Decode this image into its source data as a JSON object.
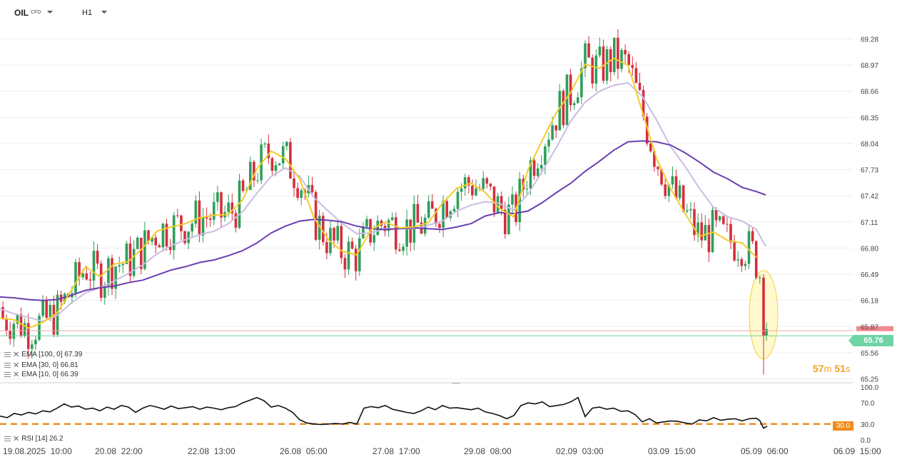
{
  "header": {
    "symbol": "OIL",
    "symbol_type": "CFD",
    "timeframe": "H1"
  },
  "legend": {
    "ema100": "EMA [100, 0] 67.39",
    "ema30": "EMA [30, 0] 66.81",
    "ema10": "EMA [10, 0] 66.39",
    "rsi": "RSI [14] 26.2"
  },
  "countdown": {
    "minutes": "57",
    "min_unit": "m",
    "seconds": "51",
    "sec_unit": "s"
  },
  "last_price": "65.76",
  "rsi_level_label": "30.0",
  "colors": {
    "up": "#2e9e5a",
    "down": "#d42f3c",
    "ema10": "#f2cc2a",
    "ema30": "#c9bde0",
    "ema100": "#6a3fb0",
    "rsi_line": "#111111",
    "rsi_level": "#f08c1c",
    "price_tag": "#6fd4a5",
    "highlight_fill": "#fff7b8",
    "highlight_stroke": "#f2d23a"
  },
  "chart_data": [
    {
      "type": "candlestick",
      "y_ticks": [
        "69.28",
        "68.97",
        "68.66",
        "68.35",
        "68.04",
        "67.73",
        "67.42",
        "67.11",
        "66.80",
        "66.49",
        "66.18",
        "65.87",
        "65.56",
        "65.25"
      ],
      "ylim": [
        65.18,
        69.55
      ],
      "x_tick_labels": [
        "19.08.2025  10:00",
        "20.08  22:00",
        "22.08  13:00",
        "26.08  05:00",
        "27.08  17:00",
        "29.08  08:00",
        "02.09  03:00",
        "03.09  15:00",
        "05.09  06:00",
        "06.09  15:00"
      ],
      "ema100": [
        [
          0,
          66.22
        ],
        [
          20,
          66.21
        ],
        [
          40,
          66.19
        ],
        [
          60,
          66.18
        ],
        [
          80,
          66.19
        ],
        [
          100,
          66.24
        ],
        [
          120,
          66.3
        ],
        [
          140,
          66.33
        ],
        [
          160,
          66.35
        ],
        [
          180,
          66.39
        ],
        [
          200,
          66.42
        ],
        [
          220,
          66.48
        ],
        [
          240,
          66.54
        ],
        [
          260,
          66.58
        ],
        [
          280,
          66.63
        ],
        [
          300,
          66.66
        ],
        [
          320,
          66.71
        ],
        [
          340,
          66.77
        ],
        [
          360,
          66.86
        ],
        [
          380,
          66.98
        ],
        [
          400,
          67.06
        ],
        [
          420,
          67.12
        ],
        [
          440,
          67.14
        ],
        [
          460,
          67.13
        ],
        [
          480,
          67.11
        ],
        [
          500,
          67.06
        ],
        [
          520,
          67.03
        ],
        [
          540,
          67.02
        ],
        [
          560,
          67.03
        ],
        [
          580,
          67.04
        ],
        [
          600,
          67.03
        ],
        [
          620,
          67.02
        ],
        [
          640,
          67.05
        ],
        [
          660,
          67.09
        ],
        [
          680,
          67.18
        ],
        [
          700,
          67.22
        ],
        [
          720,
          67.21
        ],
        [
          740,
          67.24
        ],
        [
          760,
          67.34
        ],
        [
          780,
          67.46
        ],
        [
          800,
          67.57
        ],
        [
          820,
          67.71
        ],
        [
          840,
          67.83
        ],
        [
          860,
          67.96
        ],
        [
          880,
          68.06
        ],
        [
          900,
          68.07
        ],
        [
          920,
          68.06
        ],
        [
          940,
          68.02
        ],
        [
          960,
          67.93
        ],
        [
          980,
          67.82
        ],
        [
          1000,
          67.7
        ],
        [
          1020,
          67.62
        ],
        [
          1040,
          67.52
        ],
        [
          1060,
          67.47
        ],
        [
          1073,
          67.43
        ]
      ],
      "ema30": [
        [
          0,
          66.08
        ],
        [
          20,
          66.02
        ],
        [
          40,
          65.98
        ],
        [
          60,
          65.93
        ],
        [
          80,
          66.0
        ],
        [
          100,
          66.15
        ],
        [
          120,
          66.27
        ],
        [
          140,
          66.33
        ],
        [
          160,
          66.41
        ],
        [
          180,
          66.5
        ],
        [
          200,
          66.6
        ],
        [
          220,
          66.73
        ],
        [
          240,
          66.83
        ],
        [
          260,
          66.9
        ],
        [
          280,
          66.96
        ],
        [
          300,
          67.0
        ],
        [
          320,
          67.09
        ],
        [
          340,
          67.23
        ],
        [
          360,
          67.45
        ],
        [
          380,
          67.65
        ],
        [
          400,
          67.75
        ],
        [
          420,
          67.65
        ],
        [
          440,
          67.4
        ],
        [
          460,
          67.24
        ],
        [
          480,
          67.09
        ],
        [
          500,
          66.97
        ],
        [
          520,
          66.98
        ],
        [
          540,
          67.03
        ],
        [
          560,
          67.03
        ],
        [
          580,
          67.03
        ],
        [
          600,
          67.07
        ],
        [
          620,
          67.12
        ],
        [
          640,
          67.24
        ],
        [
          660,
          67.31
        ],
        [
          680,
          67.35
        ],
        [
          700,
          67.33
        ],
        [
          720,
          67.25
        ],
        [
          740,
          67.44
        ],
        [
          760,
          67.71
        ],
        [
          780,
          68.0
        ],
        [
          800,
          68.31
        ],
        [
          820,
          68.53
        ],
        [
          840,
          68.66
        ],
        [
          860,
          68.73
        ],
        [
          880,
          68.76
        ],
        [
          900,
          68.6
        ],
        [
          920,
          68.32
        ],
        [
          940,
          68.0
        ],
        [
          960,
          67.77
        ],
        [
          980,
          67.51
        ],
        [
          1000,
          67.28
        ],
        [
          1020,
          67.17
        ],
        [
          1040,
          67.12
        ],
        [
          1060,
          67.02
        ],
        [
          1073,
          66.82
        ]
      ],
      "ema10": [
        [
          0,
          65.97
        ],
        [
          20,
          65.95
        ],
        [
          40,
          65.85
        ],
        [
          60,
          65.92
        ],
        [
          80,
          66.03
        ],
        [
          100,
          66.3
        ],
        [
          120,
          66.58
        ],
        [
          140,
          66.46
        ],
        [
          160,
          66.61
        ],
        [
          180,
          66.64
        ],
        [
          200,
          66.8
        ],
        [
          220,
          67.0
        ],
        [
          240,
          67.05
        ],
        [
          260,
          67.09
        ],
        [
          280,
          67.16
        ],
        [
          300,
          67.19
        ],
        [
          320,
          67.2
        ],
        [
          340,
          67.37
        ],
        [
          360,
          67.74
        ],
        [
          380,
          67.95
        ],
        [
          400,
          67.86
        ],
        [
          420,
          67.62
        ],
        [
          440,
          67.16
        ],
        [
          460,
          66.9
        ],
        [
          480,
          66.76
        ],
        [
          500,
          66.72
        ],
        [
          520,
          67.02
        ],
        [
          540,
          67.11
        ],
        [
          560,
          67.04
        ],
        [
          580,
          67.05
        ],
        [
          600,
          67.1
        ],
        [
          620,
          67.33
        ],
        [
          640,
          67.51
        ],
        [
          660,
          67.57
        ],
        [
          680,
          67.46
        ],
        [
          700,
          67.27
        ],
        [
          720,
          67.17
        ],
        [
          740,
          67.73
        ],
        [
          760,
          68.08
        ],
        [
          780,
          68.41
        ],
        [
          800,
          68.65
        ],
        [
          820,
          68.98
        ],
        [
          840,
          68.93
        ],
        [
          860,
          69.05
        ],
        [
          880,
          68.97
        ],
        [
          900,
          68.42
        ],
        [
          920,
          67.86
        ],
        [
          940,
          67.5
        ],
        [
          960,
          67.21
        ],
        [
          980,
          66.94
        ],
        [
          1000,
          66.99
        ],
        [
          1020,
          66.89
        ],
        [
          1040,
          66.86
        ],
        [
          1060,
          66.69
        ]
      ],
      "highlight_ellipse": {
        "center_price": 66.01,
        "center_x": 1070
      }
    },
    {
      "type": "line",
      "name": "RSI [14]",
      "y_ticks": [
        "100.0",
        "70.0",
        "30.0",
        "0.0"
      ],
      "ylim": [
        0,
        100
      ],
      "level": 30,
      "values": [
        [
          0,
          45
        ],
        [
          10,
          42
        ],
        [
          20,
          50
        ],
        [
          30,
          47
        ],
        [
          40,
          52
        ],
        [
          50,
          49
        ],
        [
          60,
          55
        ],
        [
          70,
          53
        ],
        [
          80,
          60
        ],
        [
          90,
          68
        ],
        [
          100,
          62
        ],
        [
          110,
          64
        ],
        [
          120,
          58
        ],
        [
          130,
          60
        ],
        [
          140,
          55
        ],
        [
          150,
          62
        ],
        [
          160,
          58
        ],
        [
          170,
          65
        ],
        [
          180,
          62
        ],
        [
          190,
          52
        ],
        [
          200,
          60
        ],
        [
          210,
          65
        ],
        [
          220,
          62
        ],
        [
          230,
          58
        ],
        [
          240,
          64
        ],
        [
          250,
          59
        ],
        [
          260,
          61
        ],
        [
          270,
          63
        ],
        [
          280,
          58
        ],
        [
          290,
          62
        ],
        [
          300,
          60
        ],
        [
          310,
          57
        ],
        [
          320,
          61
        ],
        [
          330,
          63
        ],
        [
          340,
          70
        ],
        [
          350,
          75
        ],
        [
          360,
          80
        ],
        [
          370,
          74
        ],
        [
          380,
          62
        ],
        [
          390,
          65
        ],
        [
          400,
          60
        ],
        [
          410,
          52
        ],
        [
          420,
          38
        ],
        [
          430,
          32
        ],
        [
          440,
          30
        ],
        [
          450,
          29
        ],
        [
          460,
          30
        ],
        [
          470,
          31
        ],
        [
          480,
          30
        ],
        [
          490,
          33
        ],
        [
          500,
          30
        ],
        [
          510,
          60
        ],
        [
          520,
          63
        ],
        [
          530,
          61
        ],
        [
          540,
          65
        ],
        [
          550,
          58
        ],
        [
          560,
          55
        ],
        [
          570,
          52
        ],
        [
          580,
          50
        ],
        [
          590,
          55
        ],
        [
          600,
          62
        ],
        [
          610,
          57
        ],
        [
          620,
          65
        ],
        [
          630,
          60
        ],
        [
          640,
          61
        ],
        [
          650,
          59
        ],
        [
          660,
          57
        ],
        [
          670,
          60
        ],
        [
          680,
          53
        ],
        [
          690,
          50
        ],
        [
          700,
          46
        ],
        [
          710,
          40
        ],
        [
          720,
          46
        ],
        [
          730,
          65
        ],
        [
          740,
          70
        ],
        [
          750,
          68
        ],
        [
          760,
          72
        ],
        [
          770,
          63
        ],
        [
          780,
          65
        ],
        [
          790,
          67
        ],
        [
          800,
          72
        ],
        [
          810,
          80
        ],
        [
          820,
          44
        ],
        [
          830,
          60
        ],
        [
          840,
          62
        ],
        [
          850,
          58
        ],
        [
          860,
          60
        ],
        [
          870,
          54
        ],
        [
          880,
          55
        ],
        [
          890,
          48
        ],
        [
          900,
          34
        ],
        [
          910,
          40
        ],
        [
          920,
          32
        ],
        [
          930,
          34
        ],
        [
          940,
          36
        ],
        [
          950,
          35
        ],
        [
          960,
          32
        ],
        [
          970,
          30
        ],
        [
          980,
          38
        ],
        [
          990,
          36
        ],
        [
          1000,
          42
        ],
        [
          1010,
          37
        ],
        [
          1020,
          39
        ],
        [
          1030,
          40
        ],
        [
          1040,
          36
        ],
        [
          1050,
          40
        ],
        [
          1060,
          41
        ],
        [
          1065,
          36
        ],
        [
          1070,
          22
        ],
        [
          1075,
          26
        ]
      ]
    }
  ]
}
